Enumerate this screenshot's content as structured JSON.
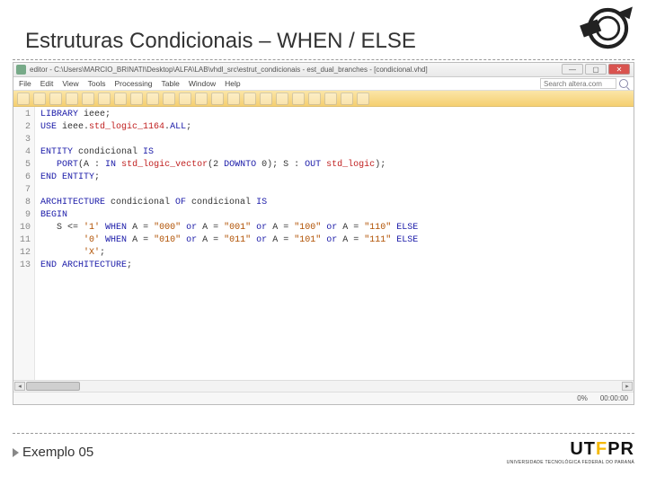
{
  "slide": {
    "title": "Estruturas Condicionais – WHEN / ELSE",
    "footer_label": "Exemplo 05"
  },
  "window": {
    "title": "editor - C:\\Users\\MARCIO_BRINATI\\Desktop\\ALFA\\LAB\\vhdl_src\\estrut_condicionais - est_dual_branches - [condicional.vhd]",
    "buttons": {
      "min": "—",
      "max": "▢",
      "close": "✕"
    }
  },
  "menubar": {
    "items": [
      "File",
      "Edit",
      "View",
      "Tools",
      "Processing",
      "Table",
      "Window",
      "Help"
    ],
    "search_placeholder": "Search altera.com",
    "search_icon": "🔍"
  },
  "toolbar": {
    "button_count": 22
  },
  "code": {
    "lines": [
      {
        "n": "1",
        "html": "<span class='kw'>LIBRARY</span> ieee;"
      },
      {
        "n": "2",
        "html": "<span class='kw'>USE</span> ieee.<span class='typ'>std_logic_1164</span>.<span class='kw'>ALL</span>;"
      },
      {
        "n": "3",
        "html": ""
      },
      {
        "n": "4",
        "html": "<span class='kw'>ENTITY</span> condicional <span class='kw'>IS</span>"
      },
      {
        "n": "5",
        "html": "   <span class='kw'>PORT</span>(A : <span class='kw'>IN</span> <span class='typ'>std_logic_vector</span>(2 <span class='kw'>DOWNTO</span> 0); S : <span class='kw'>OUT</span> <span class='typ'>std_logic</span>);"
      },
      {
        "n": "6",
        "html": "<span class='kw'>END ENTITY</span>;"
      },
      {
        "n": "7",
        "html": ""
      },
      {
        "n": "8",
        "html": "<span class='kw'>ARCHITECTURE</span> condicional <span class='kw'>OF</span> condicional <span class='kw'>IS</span>"
      },
      {
        "n": "9",
        "html": "<span class='kw'>BEGIN</span>"
      },
      {
        "n": "10",
        "html": "   S &lt;= <span class='str'>'1'</span> <span class='kw'>WHEN</span> A = <span class='str'>\"000\"</span> <span class='kw'>or</span> A = <span class='str'>\"001\"</span> <span class='kw'>or</span> A = <span class='str'>\"100\"</span> <span class='kw'>or</span> A = <span class='str'>\"110\"</span> <span class='kw'>ELSE</span>"
      },
      {
        "n": "11",
        "html": "        <span class='str'>'0'</span> <span class='kw'>WHEN</span> A = <span class='str'>\"010\"</span> <span class='kw'>or</span> A = <span class='str'>\"011\"</span> <span class='kw'>or</span> A = <span class='str'>\"101\"</span> <span class='kw'>or</span> A = <span class='str'>\"111\"</span> <span class='kw'>ELSE</span>"
      },
      {
        "n": "12",
        "html": "        <span class='str'>'X'</span>;"
      },
      {
        "n": "13",
        "html": "<span class='kw'>END ARCHITECTURE</span>;"
      }
    ]
  },
  "statusbar": {
    "percent": "0%",
    "encoding": "00:00:00"
  },
  "brand": {
    "logo_big_left": "UT",
    "logo_big_f": "F",
    "logo_big_right": "PR",
    "logo_small": "UNIVERSIDADE TECNOLÓGICA FEDERAL DO PARANÁ"
  }
}
